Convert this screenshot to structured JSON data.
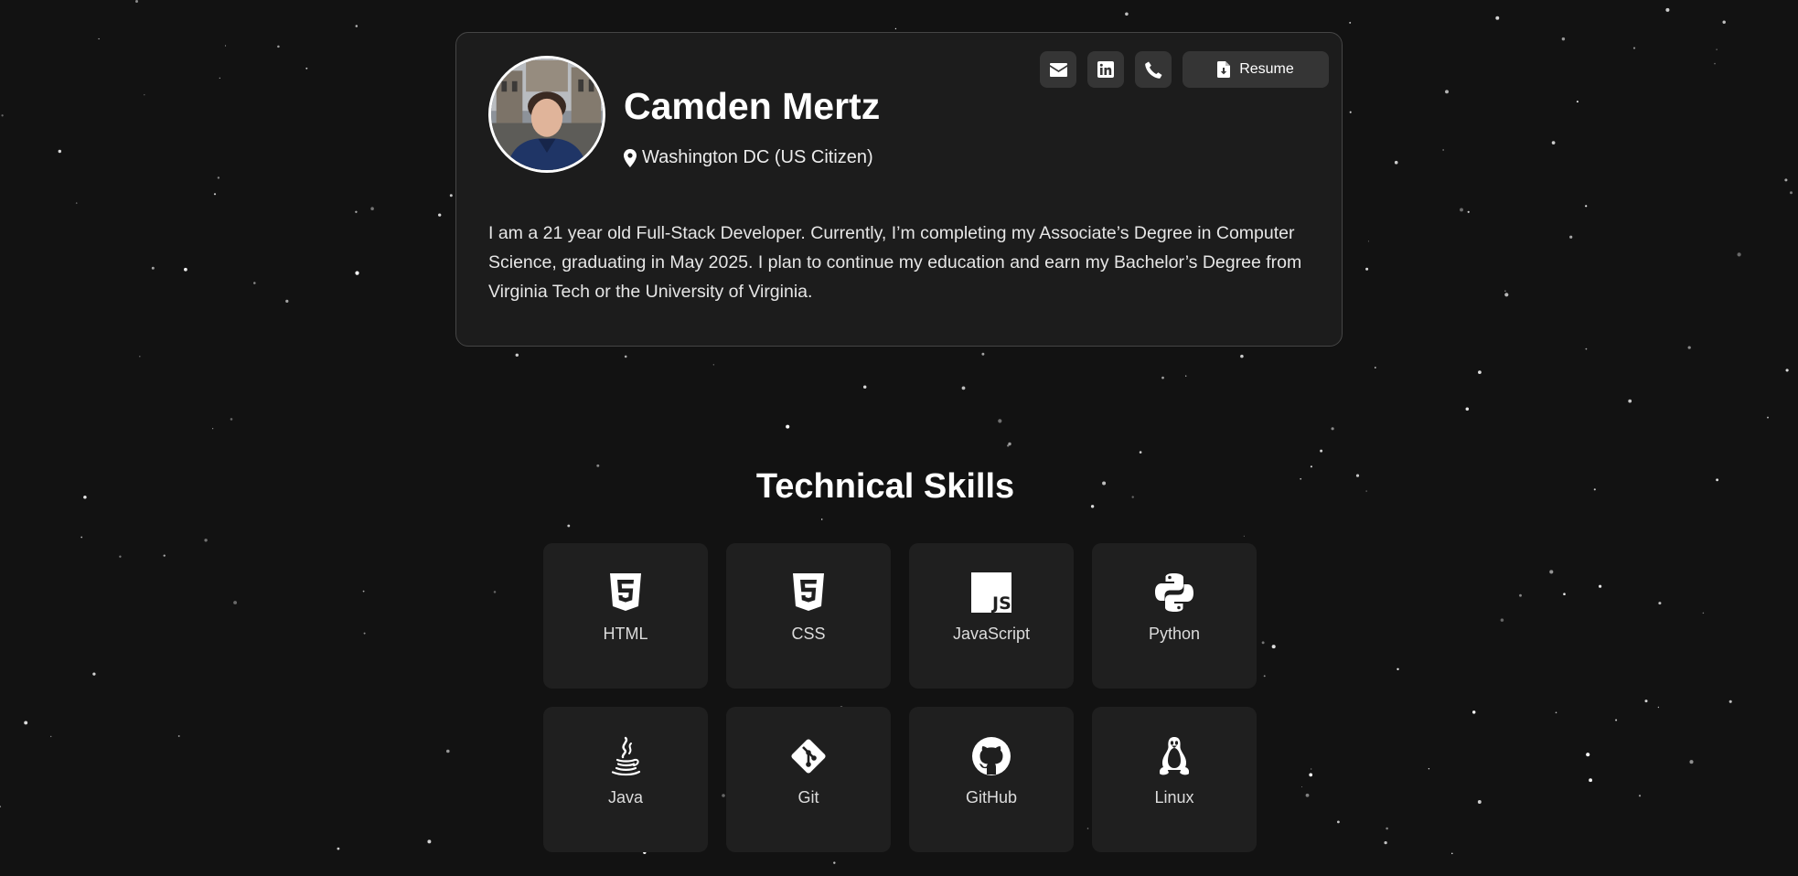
{
  "profile": {
    "name": "Camden Mertz",
    "location": "Washington DC (US Citizen)",
    "bio": "I am a 21 year old Full-Stack Developer. Currently, I’m completing my Associate’s Degree in Computer Science, graduating in May 2025. I plan to continue my education and earn my Bachelor’s Degree from Virginia Tech or the University of Virginia.",
    "avatar_icon": "profile-photo",
    "location_icon": "map-pin-icon"
  },
  "actions": {
    "email_icon": "envelope-icon",
    "linkedin_icon": "linkedin-icon",
    "phone_icon": "phone-icon",
    "resume_icon": "file-download-icon",
    "resume_label": "Resume"
  },
  "skills": {
    "title": "Technical Skills",
    "items": [
      {
        "label": "HTML",
        "icon": "html5-icon"
      },
      {
        "label": "CSS",
        "icon": "css3-icon"
      },
      {
        "label": "JavaScript",
        "icon": "javascript-icon"
      },
      {
        "label": "Python",
        "icon": "python-icon"
      },
      {
        "label": "Java",
        "icon": "java-icon"
      },
      {
        "label": "Git",
        "icon": "git-icon"
      },
      {
        "label": "GitHub",
        "icon": "github-icon"
      },
      {
        "label": "Linux",
        "icon": "linux-icon"
      }
    ]
  },
  "colors": {
    "background": "#121212",
    "card": "#1c1c1c",
    "card_border": "#454545",
    "button": "#353535",
    "skill_card": "#1f1f1f",
    "text": "#ffffff"
  }
}
